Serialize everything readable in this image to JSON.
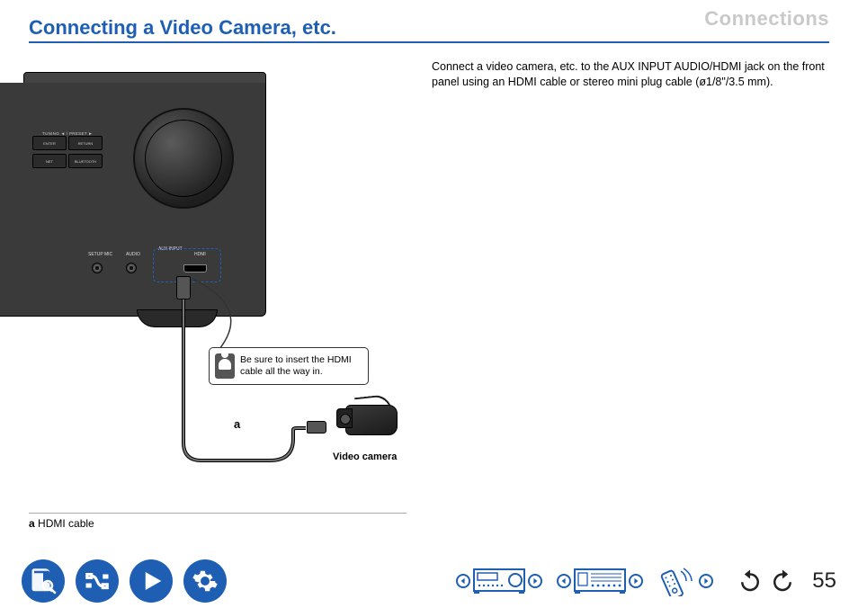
{
  "header": {
    "section": "Connections",
    "title": "Connecting a Video Camera, etc."
  },
  "intro": "Connect a video camera, etc. to the AUX INPUT AUDIO/HDMI jack on the front panel using an HDMI cable or stereo mini plug cable (ø1/8\"/3.5 mm).",
  "device": {
    "tuning_label": "TUNING ◄ / PRESET ►",
    "enter_label": "ENTER",
    "return_label": "RETURN",
    "net_label": "NET",
    "bluetooth_label": "BLUETOOTH",
    "port_setup": "SETUP MIC",
    "port_audio": "AUDIO",
    "port_aux": "AUX INPUT",
    "port_hdmi": "HDMI"
  },
  "callout": {
    "text": "Be sure to insert the HDMI cable all the way in."
  },
  "diagram": {
    "letter_a": "a",
    "camera_label": "Video camera"
  },
  "legend": {
    "a_label": "a",
    "a_text": " HDMI cable"
  },
  "footer": {
    "page_number": "55"
  }
}
